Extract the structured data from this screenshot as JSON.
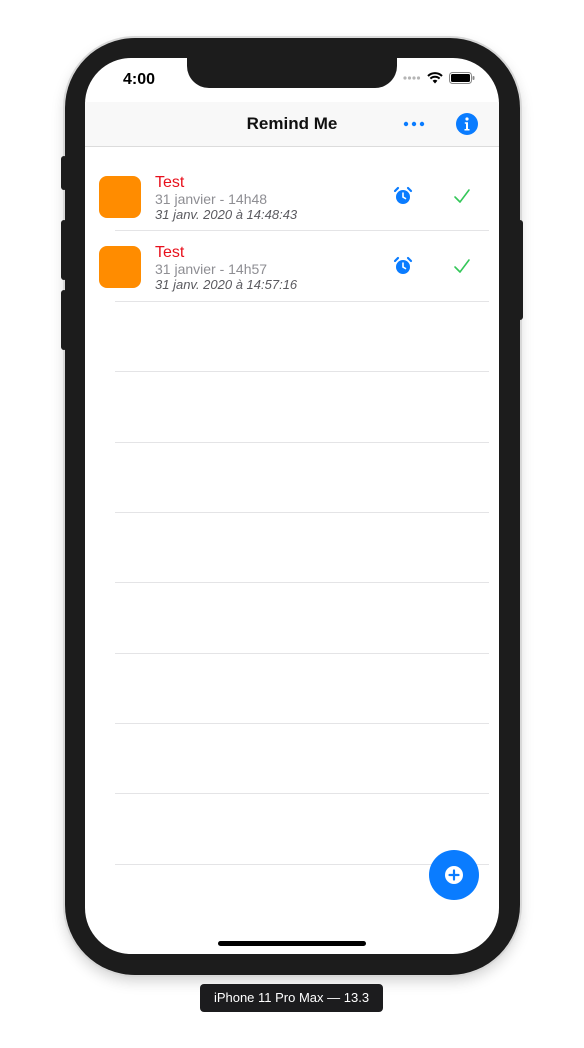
{
  "status_bar": {
    "time": "4:00"
  },
  "navbar": {
    "title": "Remind Me",
    "more_icon": "ellipsis-icon",
    "info_icon": "info-icon"
  },
  "reminders": [
    {
      "title": "Test",
      "subtitle": "31 janvier - 14h48",
      "date": "31 janv. 2020 à 14:48:43"
    },
    {
      "title": "Test",
      "subtitle": "31 janvier - 14h57",
      "date": "31 janv. 2020 à 14:57:16"
    }
  ],
  "fab": {
    "icon": "plus-circle-icon"
  },
  "device_label": "iPhone 11 Pro Max — 13.3",
  "colors": {
    "accent": "#0a7cff",
    "title_red": "#e8101c",
    "item_orange": "#ff8c00",
    "check_green": "#34c759"
  }
}
